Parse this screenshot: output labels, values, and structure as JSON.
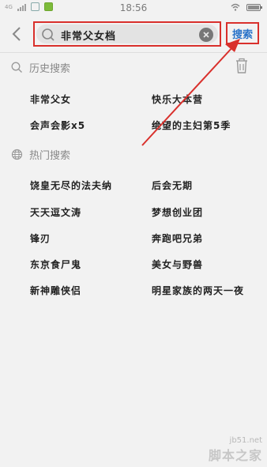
{
  "status_bar": {
    "network": "4G",
    "time": "18:56"
  },
  "search": {
    "query": "非常父女档",
    "submit_label": "搜索"
  },
  "history": {
    "title": "历史搜索",
    "items": [
      "非常父女",
      "快乐大本营",
      "会声会影x5",
      "绝望的主妇第5季"
    ]
  },
  "trending": {
    "title": "热门搜索",
    "items": [
      "饶皇无尽的法夫纳",
      "后会无期",
      "天天逗文涛",
      "梦想创业团",
      "锋刃",
      "奔跑吧兄弟",
      "东京食尸鬼",
      "美女与野兽",
      "新神雕侠侣",
      "明星家族的两天一夜"
    ]
  },
  "watermark": {
    "url": "jb51.net",
    "name": "脚本之家"
  },
  "colors": {
    "accent_blue": "#2a73c9",
    "annotation_red": "#d9302c",
    "background": "#f2f2f2"
  },
  "icons": [
    "back-arrow-icon",
    "search-icon",
    "clear-icon",
    "trash-icon",
    "clock-search-icon",
    "globe-icon"
  ]
}
